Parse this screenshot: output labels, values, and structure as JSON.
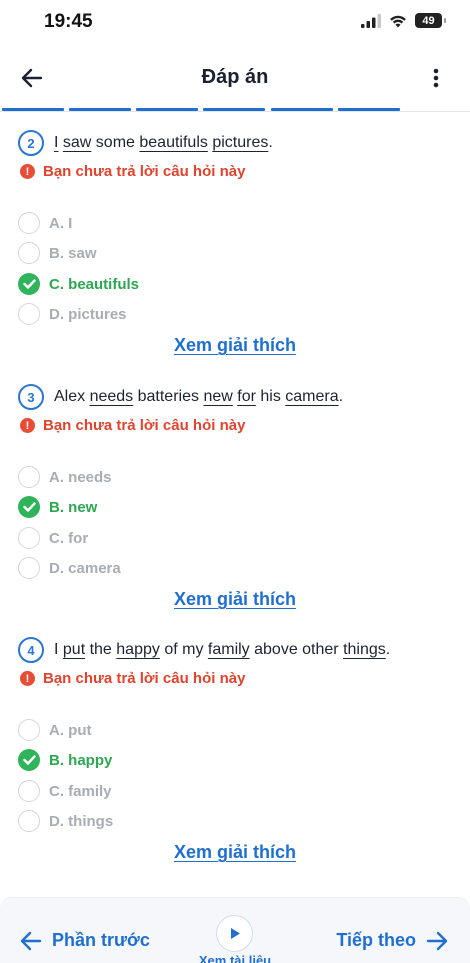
{
  "status": {
    "time": "19:45",
    "battery": "49"
  },
  "header": {
    "title": "Đáp án",
    "back_icon": "arrow-left-icon",
    "more_icon": "more-vertical-icon"
  },
  "colors": {
    "primary": "#1f6fd1",
    "correct": "#2fb45b",
    "warning": "#e74c36",
    "muted": "#a8acb3"
  },
  "warning_text": "Bạn chưa trả lời câu hỏi này",
  "explain_label": "Xem giải thích",
  "questions": [
    {
      "number": "2",
      "parts": [
        {
          "t": "I",
          "u": true
        },
        {
          "t": " "
        },
        {
          "t": "saw",
          "u": true
        },
        {
          "t": " some "
        },
        {
          "t": "beautifuls",
          "u": true
        },
        {
          "t": " "
        },
        {
          "t": "pictures",
          "u": true
        },
        {
          "t": "."
        }
      ],
      "options": [
        {
          "label": "A. I",
          "correct": false
        },
        {
          "label": "B. saw",
          "correct": false
        },
        {
          "label": "C. beautifuls",
          "correct": true
        },
        {
          "label": "D. pictures",
          "correct": false
        }
      ]
    },
    {
      "number": "3",
      "parts": [
        {
          "t": "Alex "
        },
        {
          "t": "needs",
          "u": true
        },
        {
          "t": " batteries "
        },
        {
          "t": "new",
          "u": true
        },
        {
          "t": " "
        },
        {
          "t": "for",
          "u": true
        },
        {
          "t": " his "
        },
        {
          "t": "camera",
          "u": true
        },
        {
          "t": "."
        }
      ],
      "options": [
        {
          "label": "A. needs",
          "correct": false
        },
        {
          "label": "B. new",
          "correct": true
        },
        {
          "label": "C. for",
          "correct": false
        },
        {
          "label": "D. camera",
          "correct": false
        }
      ]
    },
    {
      "number": "4",
      "parts": [
        {
          "t": "I "
        },
        {
          "t": "put",
          "u": true
        },
        {
          "t": " the "
        },
        {
          "t": "happy",
          "u": true
        },
        {
          "t": " of my "
        },
        {
          "t": "family",
          "u": true
        },
        {
          "t": " above other "
        },
        {
          "t": "things",
          "u": true
        },
        {
          "t": "."
        }
      ],
      "options": [
        {
          "label": "A. put",
          "correct": false
        },
        {
          "label": "B. happy",
          "correct": true
        },
        {
          "label": "C. family",
          "correct": false
        },
        {
          "label": "D. things",
          "correct": false
        }
      ]
    }
  ],
  "bottom": {
    "prev_label": "Phần trước",
    "next_label": "Tiếp theo",
    "doc_label": "Xem tài liệu",
    "play_icon": "play-icon"
  }
}
